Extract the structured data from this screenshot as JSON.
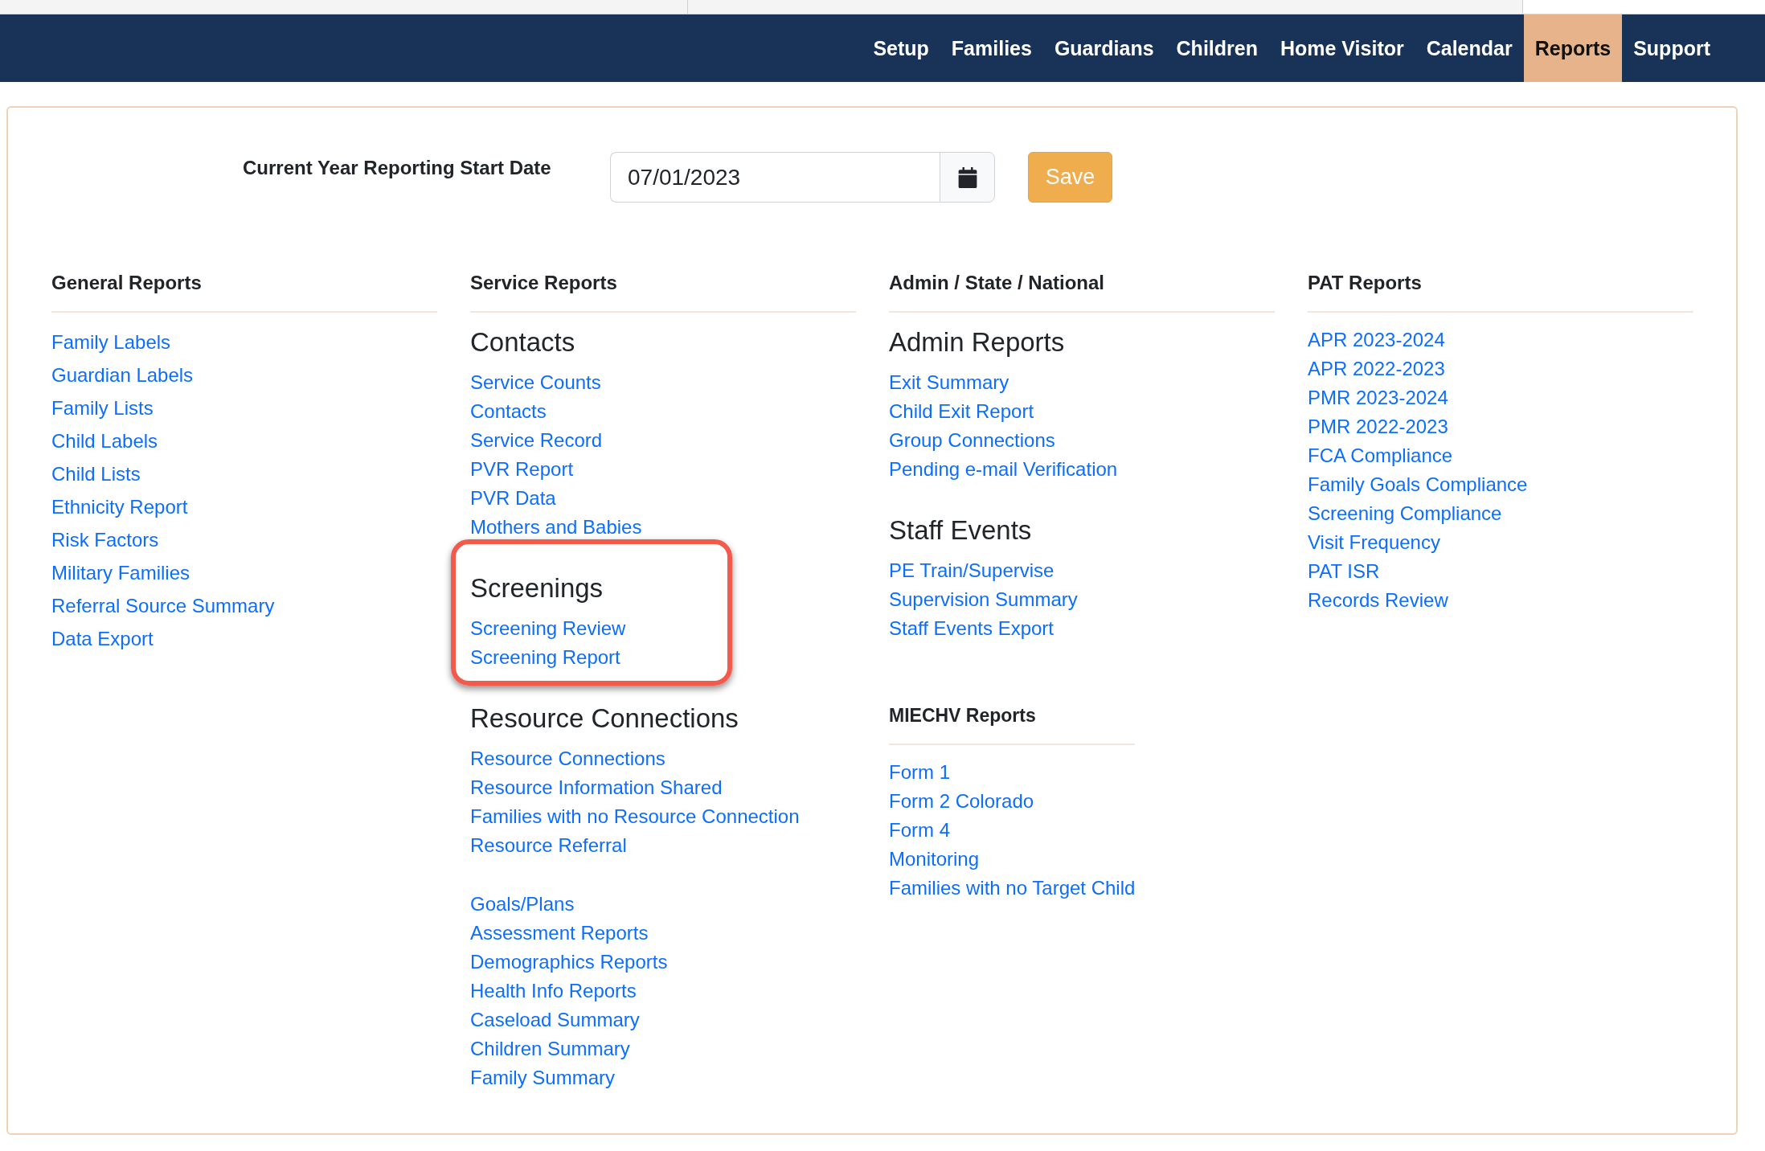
{
  "nav": {
    "items": [
      {
        "label": "Setup",
        "selected": false
      },
      {
        "label": "Families",
        "selected": false
      },
      {
        "label": "Guardians",
        "selected": false
      },
      {
        "label": "Children",
        "selected": false
      },
      {
        "label": "Home Visitor",
        "selected": false
      },
      {
        "label": "Calendar",
        "selected": false
      },
      {
        "label": "Reports",
        "selected": true
      },
      {
        "label": "Support",
        "selected": false
      }
    ]
  },
  "start_date": {
    "label": "Current Year Reporting Start Date",
    "value": "07/01/2023",
    "button": "Save"
  },
  "columns": [
    {
      "heading": "General Reports",
      "groups": [
        {
          "kind": "plain",
          "highlighted": false,
          "links": [
            "Family Labels",
            "Guardian Labels",
            "Family Lists",
            "Child Labels",
            "Child Lists",
            "Ethnicity Report",
            "Risk Factors",
            "Military Families",
            "Referral Source Summary",
            "Data Export"
          ]
        }
      ]
    },
    {
      "heading": "Service Reports",
      "groups": [
        {
          "kind": "section",
          "title": "Contacts",
          "highlighted": false,
          "links": [
            "Service Counts",
            "Contacts",
            "Service Record",
            "PVR Report",
            "PVR Data",
            "Mothers and Babies"
          ]
        },
        {
          "kind": "section",
          "title": "Screenings",
          "highlighted": true,
          "links": [
            "Screening Review",
            "Screening Report"
          ]
        },
        {
          "kind": "section",
          "title": "Resource Connections",
          "highlighted": false,
          "links": [
            "Resource Connections",
            "Resource Information Shared",
            "Families with no Resource Connection",
            "Resource Referral"
          ]
        },
        {
          "kind": "plain",
          "highlighted": false,
          "links": [
            "Goals/Plans",
            "Assessment Reports",
            "Demographics Reports",
            "Health Info Reports",
            "Caseload Summary",
            "Children Summary",
            "Family Summary"
          ]
        }
      ]
    },
    {
      "heading": "Admin / State / National",
      "groups": [
        {
          "kind": "section",
          "title": "Admin Reports",
          "highlighted": false,
          "links": [
            "Exit Summary",
            "Child Exit Report",
            "Group Connections",
            "Pending e-mail Verification"
          ]
        },
        {
          "kind": "section",
          "title": "Staff Events",
          "highlighted": false,
          "links": [
            "PE Train/Supervise",
            "Supervision Summary",
            "Staff Events Export"
          ]
        },
        {
          "kind": "header",
          "title": "MIECHV Reports",
          "highlighted": false,
          "links": [
            "Form 1",
            "Form 2 Colorado",
            "Form 4",
            "Monitoring",
            "Families with no Target Child"
          ]
        }
      ]
    },
    {
      "heading": "PAT Reports",
      "groups": [
        {
          "kind": "plain",
          "highlighted": false,
          "links": [
            "APR 2023-2024",
            "APR 2022-2023",
            "PMR 2023-2024",
            "PMR 2022-2023",
            "FCA Compliance",
            "Family Goals Compliance",
            "Screening Compliance",
            "Visit Frequency",
            "PAT ISR",
            "Records Review"
          ]
        }
      ]
    }
  ]
}
